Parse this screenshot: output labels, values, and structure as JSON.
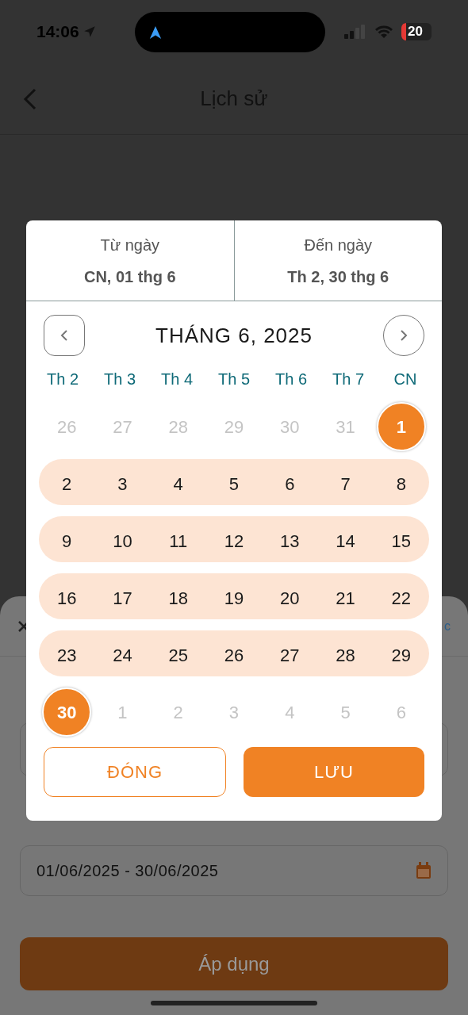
{
  "status_bar": {
    "time": "14:06",
    "battery": "20"
  },
  "header": {
    "title": "Lịch sử"
  },
  "sheet": {
    "link_fragment": "c",
    "date_range_value": "01/06/2025 - 30/06/2025",
    "apply_button": "Áp dụng"
  },
  "picker": {
    "from_label": "Từ ngày",
    "from_value": "CN, 01 thg 6",
    "to_label": "Đến ngày",
    "to_value": "Th 2, 30 thg 6",
    "month": "THÁNG 6, 2025",
    "weekdays": [
      "Th 2",
      "Th 3",
      "Th 4",
      "Th 5",
      "Th 6",
      "Th 7",
      "CN"
    ],
    "weeks": [
      {
        "in_range": false,
        "days": [
          {
            "label": "26",
            "kind": "muted"
          },
          {
            "label": "27",
            "kind": "muted"
          },
          {
            "label": "28",
            "kind": "muted"
          },
          {
            "label": "29",
            "kind": "muted"
          },
          {
            "label": "30",
            "kind": "muted"
          },
          {
            "label": "31",
            "kind": "muted"
          },
          {
            "label": "1",
            "kind": "selected"
          }
        ]
      },
      {
        "in_range": true,
        "days": [
          {
            "label": "2",
            "kind": "normal"
          },
          {
            "label": "3",
            "kind": "normal"
          },
          {
            "label": "4",
            "kind": "normal"
          },
          {
            "label": "5",
            "kind": "normal"
          },
          {
            "label": "6",
            "kind": "normal"
          },
          {
            "label": "7",
            "kind": "normal"
          },
          {
            "label": "8",
            "kind": "normal"
          }
        ]
      },
      {
        "in_range": true,
        "days": [
          {
            "label": "9",
            "kind": "normal"
          },
          {
            "label": "10",
            "kind": "normal"
          },
          {
            "label": "11",
            "kind": "normal"
          },
          {
            "label": "12",
            "kind": "normal"
          },
          {
            "label": "13",
            "kind": "normal"
          },
          {
            "label": "14",
            "kind": "normal"
          },
          {
            "label": "15",
            "kind": "normal"
          }
        ]
      },
      {
        "in_range": true,
        "days": [
          {
            "label": "16",
            "kind": "normal"
          },
          {
            "label": "17",
            "kind": "normal"
          },
          {
            "label": "18",
            "kind": "normal"
          },
          {
            "label": "19",
            "kind": "normal"
          },
          {
            "label": "20",
            "kind": "normal"
          },
          {
            "label": "21",
            "kind": "normal"
          },
          {
            "label": "22",
            "kind": "normal"
          }
        ]
      },
      {
        "in_range": true,
        "days": [
          {
            "label": "23",
            "kind": "normal"
          },
          {
            "label": "24",
            "kind": "normal"
          },
          {
            "label": "25",
            "kind": "normal"
          },
          {
            "label": "26",
            "kind": "normal"
          },
          {
            "label": "27",
            "kind": "normal"
          },
          {
            "label": "28",
            "kind": "normal"
          },
          {
            "label": "29",
            "kind": "normal"
          }
        ]
      },
      {
        "in_range": false,
        "days": [
          {
            "label": "30",
            "kind": "selected"
          },
          {
            "label": "1",
            "kind": "muted"
          },
          {
            "label": "2",
            "kind": "muted"
          },
          {
            "label": "3",
            "kind": "muted"
          },
          {
            "label": "4",
            "kind": "muted"
          },
          {
            "label": "5",
            "kind": "muted"
          },
          {
            "label": "6",
            "kind": "muted"
          }
        ]
      }
    ],
    "close_button": "ĐÓNG",
    "save_button": "LƯU"
  }
}
